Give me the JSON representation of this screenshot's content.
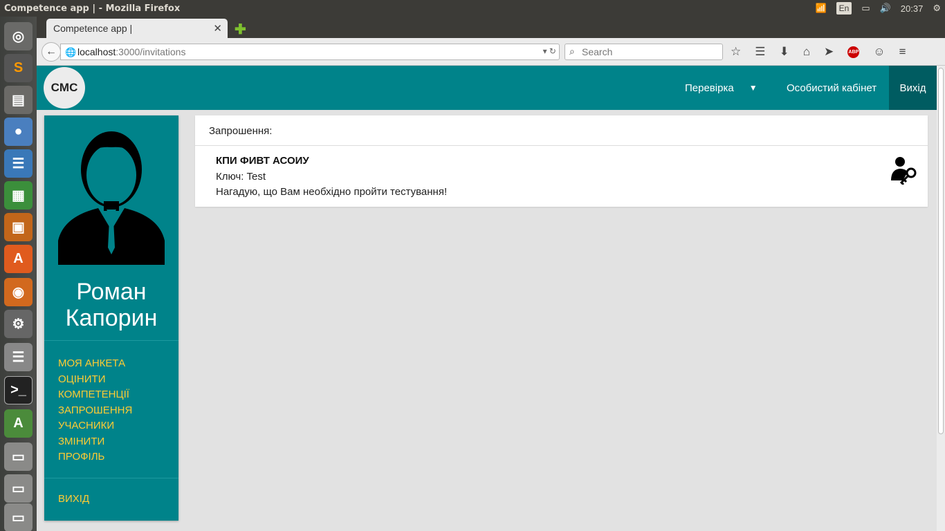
{
  "os": {
    "window_title": "Competence app | - Mozilla Firefox",
    "keyboard_layout": "En",
    "clock": "20:37"
  },
  "browser": {
    "tab_title": "Competence app |",
    "url_host": "localhost",
    "url_path": ":3000/invitations",
    "search_placeholder": "Search"
  },
  "app": {
    "logo": "CMC",
    "nav": {
      "check": "Перевірка",
      "profile": "Особистий кабінет",
      "exit": "Вихід"
    },
    "sidebar": {
      "user_name": "Роман Капорин",
      "items": [
        "Моя анкета",
        "Оцінити",
        "компетенції",
        "Запрошення",
        "Учасники",
        "Змінити",
        "профіль"
      ],
      "logout": "Вихід"
    },
    "invitations": {
      "title": "Запрошення:",
      "items": [
        {
          "org": "КПИ ФИВТ АСОИУ",
          "key": "Ключ: Test",
          "message": "Нагадую, що Вам необхідно пройти тестування!"
        }
      ]
    },
    "colors": {
      "primary": "#00838a",
      "primary_dark": "#005c61",
      "accent": "#ffcc33",
      "background": "#e2e2e2"
    }
  }
}
